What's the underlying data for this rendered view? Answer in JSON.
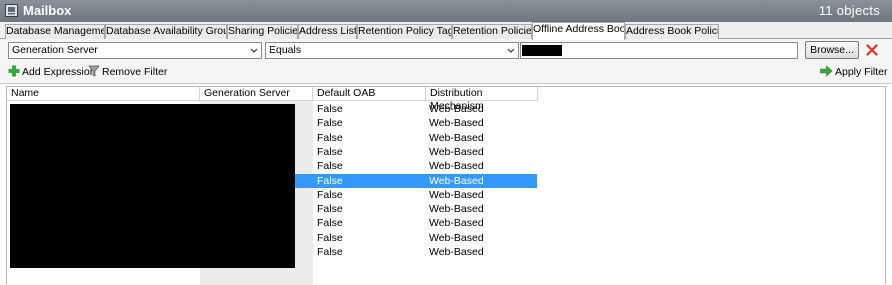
{
  "window": {
    "title": "Mailbox",
    "object_count": "11 objects"
  },
  "tabs": [
    {
      "label": "Database Management",
      "active": false
    },
    {
      "label": "Database Availability Groups",
      "active": false
    },
    {
      "label": "Sharing Policies",
      "active": false
    },
    {
      "label": "Address Lists",
      "active": false
    },
    {
      "label": "Retention Policy Tags",
      "active": false
    },
    {
      "label": "Retention Policies",
      "active": false
    },
    {
      "label": "Offline Address Book",
      "active": true
    },
    {
      "label": "Address Book Policies",
      "active": false
    }
  ],
  "filter": {
    "field_value": "Generation Server",
    "operator_value": "Equals",
    "value_redacted": true,
    "browse_label": "Browse...",
    "add_expression_label": "Add Expression",
    "remove_filter_label": "Remove Filter",
    "apply_filter_label": "Apply Filter"
  },
  "grid": {
    "columns": [
      "Name",
      "Generation Server",
      "Default OAB",
      "Distribution Mechanism"
    ],
    "rows": [
      {
        "default_oab": "False",
        "distribution": "Web-Based",
        "selected": false
      },
      {
        "default_oab": "False",
        "distribution": "Web-Based",
        "selected": false
      },
      {
        "default_oab": "False",
        "distribution": "Web-Based",
        "selected": false
      },
      {
        "default_oab": "False",
        "distribution": "Web-Based",
        "selected": false
      },
      {
        "default_oab": "False",
        "distribution": "Web-Based",
        "selected": false
      },
      {
        "default_oab": "False",
        "distribution": "Web-Based",
        "selected": true
      },
      {
        "default_oab": "False",
        "distribution": "Web-Based",
        "selected": false
      },
      {
        "default_oab": "False",
        "distribution": "Web-Based",
        "selected": false
      },
      {
        "default_oab": "False",
        "distribution": "Web-Based",
        "selected": false
      },
      {
        "default_oab": "False",
        "distribution": "Web-Based",
        "selected": false
      },
      {
        "default_oab": "False",
        "distribution": "Web-Based",
        "selected": false
      }
    ]
  },
  "icons": {
    "app": "mailbox-icon",
    "add": "green-plus-icon",
    "remove": "funnel-remove-icon",
    "apply": "green-arrow-icon",
    "clear": "red-x-icon"
  },
  "colors": {
    "selection": "#3399ff",
    "titlebar": "#777e86",
    "clear_x": "#e0301e",
    "add_green": "#3aa83a"
  }
}
